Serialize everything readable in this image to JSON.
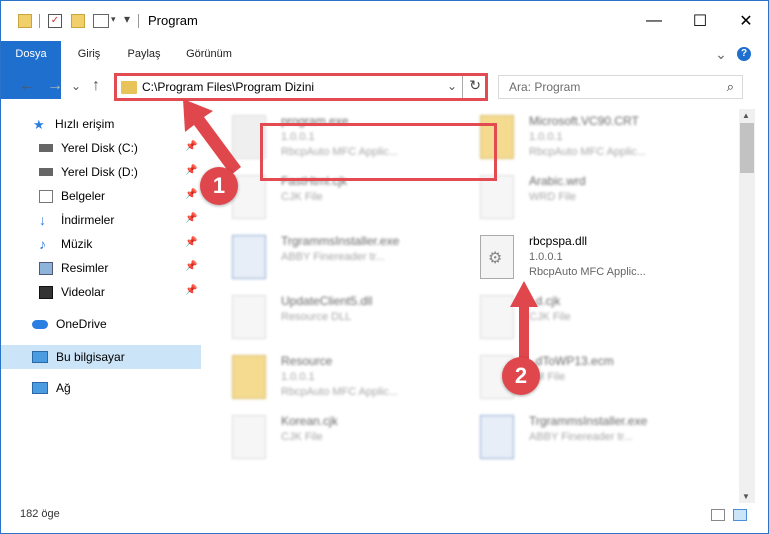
{
  "window": {
    "title": "Program",
    "minimize": "—",
    "maximize": "☐",
    "close": "✕"
  },
  "ribbon": {
    "tabs": [
      "Dosya",
      "Giriş",
      "Paylaş",
      "Görünüm"
    ],
    "collapse": "⌄",
    "help": "?"
  },
  "nav": {
    "back": "←",
    "forward": "→",
    "dropdown": "⌄",
    "up": "↑"
  },
  "address": {
    "path": "C:\\Program Files\\Program Dizini",
    "dropdown": "⌄",
    "refresh": "↻"
  },
  "search": {
    "placeholder": "Ara: Program",
    "icon": "search-icon"
  },
  "sidebar": {
    "quick_access": "Hızlı erişim",
    "items": [
      {
        "label": "Yerel Disk (C:)",
        "icon": "drive-icon"
      },
      {
        "label": "Yerel Disk (D:)",
        "icon": "drive-icon"
      },
      {
        "label": "Belgeler",
        "icon": "documents-icon"
      },
      {
        "label": "İndirmeler",
        "icon": "downloads-icon"
      },
      {
        "label": "Müzik",
        "icon": "music-icon"
      },
      {
        "label": "Resimler",
        "icon": "pictures-icon"
      },
      {
        "label": "Videolar",
        "icon": "videos-icon"
      }
    ],
    "onedrive": "OneDrive",
    "thispc": "Bu bilgisayar",
    "network": "Ağ",
    "pin": "📌"
  },
  "files": [
    {
      "name": "program.exe",
      "l2": "1.0.0.1",
      "l3": "RbcpAuto MFC Applic..."
    },
    {
      "name": "Microsoft.VC90.CRT",
      "l2": "1.0.0.1",
      "l3": "RbcpAuto MFC Applic..."
    },
    {
      "name": "FastHtml.cjk",
      "l2": "CJK File",
      "l3": ""
    },
    {
      "name": "Arabic.wrd",
      "l2": "WRD File",
      "l3": ""
    },
    {
      "name": "TrgrammsInstaller.exe",
      "l2": "ABBY Finereader tr...",
      "l3": ""
    },
    {
      "name": "rbcpspa.dll",
      "l2": "1.0.0.1",
      "l3": "RbcpAuto MFC Applic..."
    },
    {
      "name": "UpdateClient5.dll",
      "l2": "Resource DLL",
      "l3": ""
    },
    {
      "name": "..d.cjk",
      "l2": "CJK File",
      "l3": ""
    },
    {
      "name": "Resource",
      "l2": "1.0.0.1",
      "l3": "RbcpAuto MFC Applic..."
    },
    {
      "name": "..dToWP13.ecm",
      "l2": "..M File",
      "l3": ""
    },
    {
      "name": "Korean.cjk",
      "l2": "CJK File",
      "l3": ""
    },
    {
      "name": "TrgrammsInstaller.exe",
      "l2": "ABBY Finereader tr...",
      "l3": ""
    }
  ],
  "annotations": {
    "step1": "1",
    "step2": "2"
  },
  "status": {
    "count": "182 öge"
  },
  "colors": {
    "accent": "#1f6fce",
    "highlight": "#e34b52",
    "selected": "#cce4f7"
  }
}
